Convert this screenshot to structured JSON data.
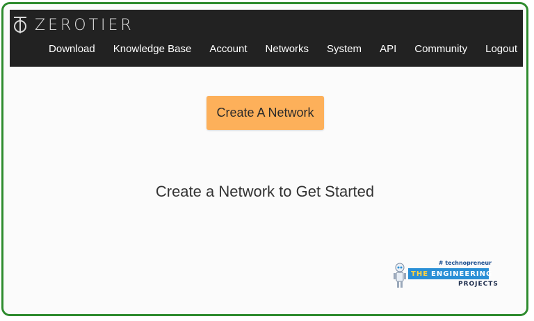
{
  "brand": {
    "name": "ZEROTIER"
  },
  "nav": {
    "items": [
      {
        "label": "Download"
      },
      {
        "label": "Knowledge Base"
      },
      {
        "label": "Account"
      },
      {
        "label": "Networks"
      },
      {
        "label": "System"
      },
      {
        "label": "API"
      },
      {
        "label": "Community"
      },
      {
        "label": "Logout"
      }
    ]
  },
  "main": {
    "create_button_label": "Create A Network",
    "headline": "Create a Network to Get Started"
  },
  "watermark": {
    "tag": "# technopreneur",
    "the": "THE",
    "engineering": "ENGINEERING",
    "projects": "PROJECTS"
  },
  "colors": {
    "accent": "#fdb05a",
    "topbar": "#222222",
    "frame": "#2e8b2e"
  }
}
